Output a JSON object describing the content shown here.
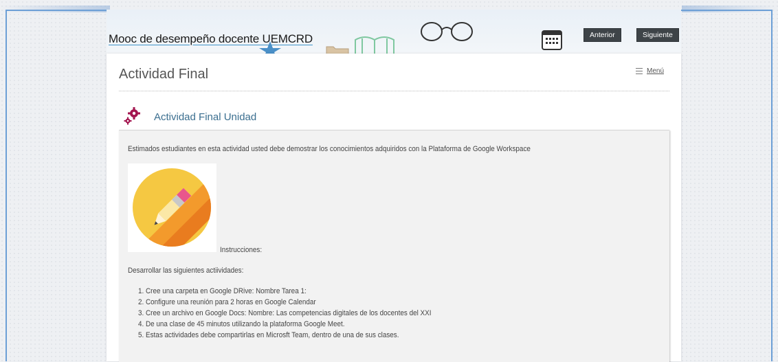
{
  "header": {
    "course_title": "Mooc de desempeño docente UEMCRD",
    "prev_button": "Anterior",
    "next_button": "Siguiente"
  },
  "page": {
    "title": "Actividad Final",
    "menu_label": "Menú"
  },
  "activity": {
    "title": "Actividad Final Unidad",
    "intro": "Estimados estudiantes en esta actividad usted debe demostrar los conocimientos adquiridos con la Plataforma de Google Workspace",
    "image_caption": "Instrucciones:",
    "lead": "Desarrollar las siguientes actiividades:",
    "steps": [
      "1. Cree una carpeta en Google DRive: Nombre Tarea 1:",
      "2. Configure una reunión para 2 horas en Google Calendar",
      "3. Cree un archivo en Google Docs: Nombre: Las competencias digitales de los docentes del XXI",
      "4. De una clase de 45 minutos utilizando la plataforma Google Meet.",
      "5. Estas actividades debe compartirlas en Microsft Team, dentro de una de sus clases."
    ]
  },
  "colors": {
    "frame": "#6c9fd6",
    "button_bg": "#3e4448",
    "activity_icon": "#a3154f",
    "activity_title": "#3a6e8f",
    "pencil_bg": "#f5c842"
  },
  "icons": [
    "calendar-icon",
    "glasses-icon",
    "book-icon",
    "folder-icon",
    "star-icon",
    "menu-icon",
    "activity-gear-icon",
    "pencil-image"
  ]
}
